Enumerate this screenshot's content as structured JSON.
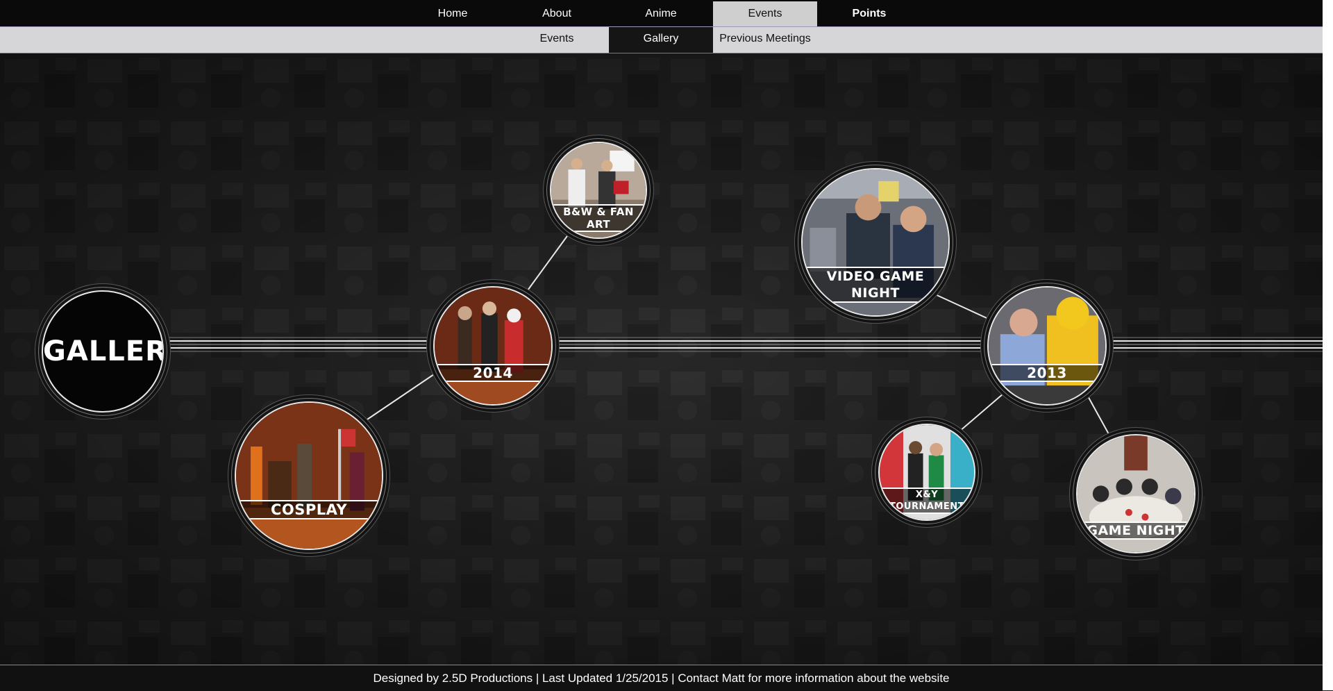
{
  "nav": {
    "items": [
      {
        "label": "Home"
      },
      {
        "label": "About"
      },
      {
        "label": "Anime"
      },
      {
        "label": "Events"
      },
      {
        "label": "Points"
      }
    ],
    "active_index": 3
  },
  "subnav": {
    "items": [
      {
        "label": "Events"
      },
      {
        "label": "Gallery"
      },
      {
        "label": "Previous Meetings"
      }
    ],
    "active_index": 1
  },
  "gallery": {
    "title": "GALLERY",
    "bubbles": {
      "y2014": {
        "caption": "2014",
        "icon": "photo-costumes"
      },
      "bwfanart": {
        "caption": "B&W & FAN ART",
        "icon": "photo-fanart"
      },
      "cosplay": {
        "caption": "COSPLAY",
        "icon": "photo-cosplay-stage"
      },
      "y2013": {
        "caption": "2013",
        "icon": "photo-pikachu-hoodie"
      },
      "videogame": {
        "caption": "VIDEO GAME NIGHT",
        "icon": "photo-gamers"
      },
      "xy": {
        "caption": "X&Y TOURNAMENT",
        "icon": "photo-tournament"
      },
      "gamenight": {
        "caption": "GAME NIGHT",
        "icon": "photo-table-game"
      }
    }
  },
  "footer": {
    "text": "Designed by 2.5D Productions | Last Updated 1/25/2015 | Contact Matt for more information about the website"
  },
  "colors": {
    "nav_bg": "#0a0a0a",
    "nav_active_bg": "#cfcfcf",
    "subnav_bg": "#d6d6d8",
    "subnav_active_bg": "#151515",
    "timeline_line": "#e0e0e0"
  }
}
